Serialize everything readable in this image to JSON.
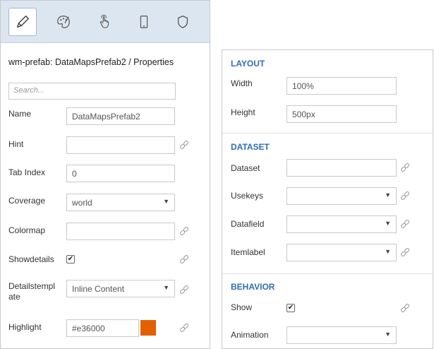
{
  "left_panel": {
    "toolbar": {
      "tools": [
        {
          "icon": "pencil-icon",
          "active": true
        },
        {
          "icon": "palette-icon",
          "active": false
        },
        {
          "icon": "touch-icon",
          "active": false
        },
        {
          "icon": "mobile-icon",
          "active": false
        },
        {
          "icon": "shield-icon",
          "active": false
        }
      ]
    },
    "title": "wm-prefab: DataMapsPrefab2 / Properties",
    "search_placeholder": "Search...",
    "rows": {
      "name": {
        "label": "Name",
        "value": "DataMapsPrefab2"
      },
      "hint": {
        "label": "Hint",
        "value": ""
      },
      "tabindex": {
        "label": "Tab Index",
        "value": "0"
      },
      "coverage": {
        "label": "Coverage",
        "value": "world"
      },
      "colormap": {
        "label": "Colormap",
        "value": ""
      },
      "showdetails": {
        "label": "Showdetails",
        "checked": true
      },
      "detailstemplate": {
        "label_line1": "Detailstempl",
        "label_line2": "ate",
        "value": "Inline Content"
      },
      "highlight": {
        "label": "Highlight",
        "value": "#e36000",
        "color": "#e36000"
      }
    }
  },
  "right_panel": {
    "layout": {
      "title": "LAYOUT",
      "width": {
        "label": "Width",
        "value": "100%"
      },
      "height": {
        "label": "Height",
        "value": "500px"
      }
    },
    "dataset": {
      "title": "DATASET",
      "dataset": {
        "label": "Dataset",
        "value": ""
      },
      "usekeys": {
        "label": "Usekeys",
        "value": ""
      },
      "datafield": {
        "label": "Datafield",
        "value": ""
      },
      "itemlabel": {
        "label": "Itemlabel",
        "value": ""
      }
    },
    "behavior": {
      "title": "BEHAVIOR",
      "show": {
        "label": "Show",
        "checked": true
      },
      "animation": {
        "label": "Animation",
        "value": ""
      }
    }
  },
  "colors": {
    "toolbar_bg": "#dce6f1",
    "accent_blue": "#2f6db5",
    "highlight_swatch": "#e36000"
  }
}
